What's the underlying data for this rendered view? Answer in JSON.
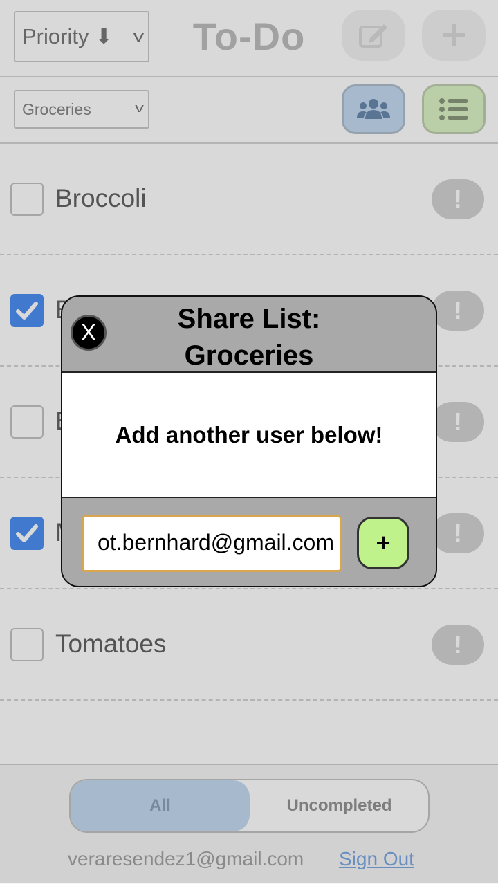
{
  "header": {
    "sort": {
      "selected": "Priority ⬇"
    },
    "title": "To-Do",
    "edit_icon": "pencil-square-icon",
    "add_icon": "plus-icon"
  },
  "toolbar": {
    "list_select": {
      "selected": "Groceries"
    },
    "share_icon": "users-icon",
    "lists_icon": "list-icon"
  },
  "items": [
    {
      "label": "Broccoli",
      "checked": false,
      "priority": "!"
    },
    {
      "label": "B",
      "checked": true,
      "priority": "!"
    },
    {
      "label": "B",
      "checked": false,
      "priority": "!"
    },
    {
      "label": "M",
      "checked": true,
      "priority": "!"
    },
    {
      "label": "Tomatoes",
      "checked": false,
      "priority": "!"
    }
  ],
  "footer": {
    "filters": [
      "All",
      "Uncompleted"
    ],
    "active_filter": "All",
    "user_email": "veraresendez1@gmail.com",
    "sign_out": "Sign Out"
  },
  "modal": {
    "close_label": "X",
    "title": "Share List: Groceries",
    "message": "Add another user below!",
    "email_value": "ot.bernhard@gmail.com",
    "submit_label": "+"
  },
  "colors": {
    "accent_blue": "#3b84f0",
    "share_button": "#bfd6f0",
    "lists_button": "#d8f2c0",
    "submit_button": "#bff28a",
    "input_focus_border": "#d9a64e",
    "modal_bg": "#a9a9a9"
  }
}
